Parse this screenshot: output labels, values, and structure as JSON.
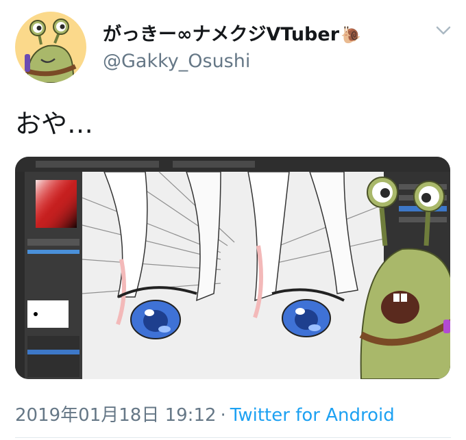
{
  "tweet": {
    "author": {
      "display_name": "がっきー∞ナメクジVTuber",
      "name_emoji": "🐌",
      "handle": "@Gakky_Osushi",
      "avatar_icon": "snail-character-avatar"
    },
    "text": "おや…",
    "timestamp": "2019年01月18日 19:12",
    "separator": "·",
    "source": "Twitter for Android",
    "menu_icon": "chevron-down-icon"
  },
  "colors": {
    "text_primary": "#14171a",
    "text_secondary": "#657786",
    "link": "#1da1f2",
    "avatar_bg": "#fbd98b",
    "eye_blue": "#3f72d6",
    "snail_green": "#a9b86a"
  }
}
